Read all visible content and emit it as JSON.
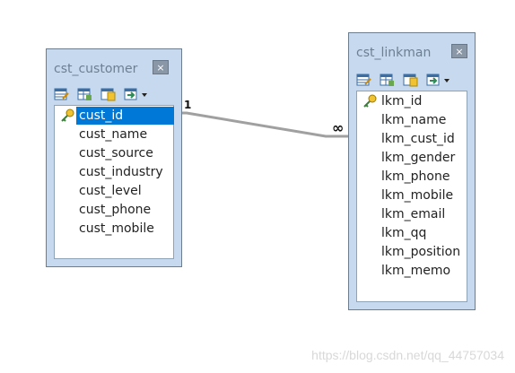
{
  "tables": {
    "customer": {
      "title": "cst_customer",
      "fields": [
        "cust_id",
        "cust_name",
        "cust_source",
        "cust_industry",
        "cust_level",
        "cust_phone",
        "cust_mobile"
      ],
      "primary_key": "cust_id",
      "selected_field": "cust_id"
    },
    "linkman": {
      "title": "cst_linkman",
      "fields": [
        "lkm_id",
        "lkm_name",
        "lkm_cust_id",
        "lkm_gender",
        "lkm_phone",
        "lkm_mobile",
        "lkm_email",
        "lkm_qq",
        "lkm_position",
        "lkm_memo"
      ],
      "primary_key": "lkm_id"
    }
  },
  "relationship": {
    "one_label": "1",
    "many_label": "∞"
  },
  "close_glyph": "×",
  "watermark": "https://blog.csdn.net/qq_44757034",
  "colors": {
    "panel": "#c6d9ee",
    "selection": "#0078d7",
    "connector": "#999999"
  }
}
